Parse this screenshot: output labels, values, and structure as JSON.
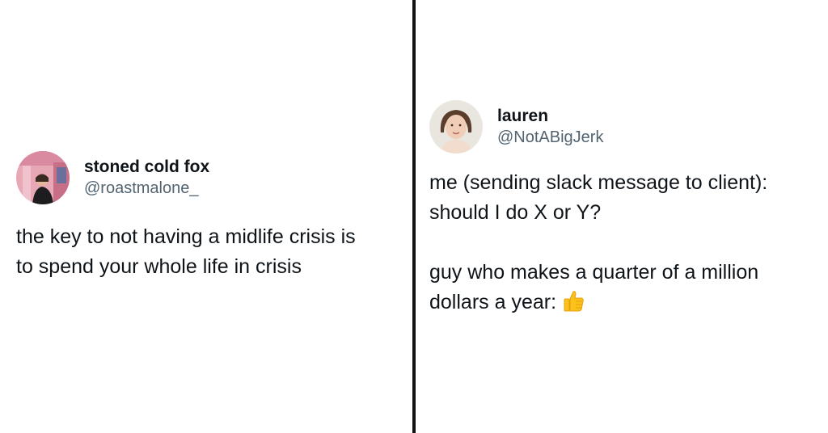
{
  "tweets": [
    {
      "display_name": "stoned cold fox",
      "handle": "@roastmalone_",
      "text_lines": [
        "the key to not having a midlife crisis is",
        "to spend your whole life in crisis"
      ]
    },
    {
      "display_name": "lauren",
      "handle": "@NotABigJerk",
      "paragraph1_lines": [
        "me (sending slack message to client):",
        "should I do X or Y?"
      ],
      "paragraph2_lines": [
        "guy who makes a quarter of a million",
        "dollars a year:"
      ],
      "emoji": "thumbs-up-icon"
    }
  ],
  "colors": {
    "text": "#0f1419",
    "handle": "#536471",
    "divider": "#111111",
    "background": "#ffffff"
  }
}
